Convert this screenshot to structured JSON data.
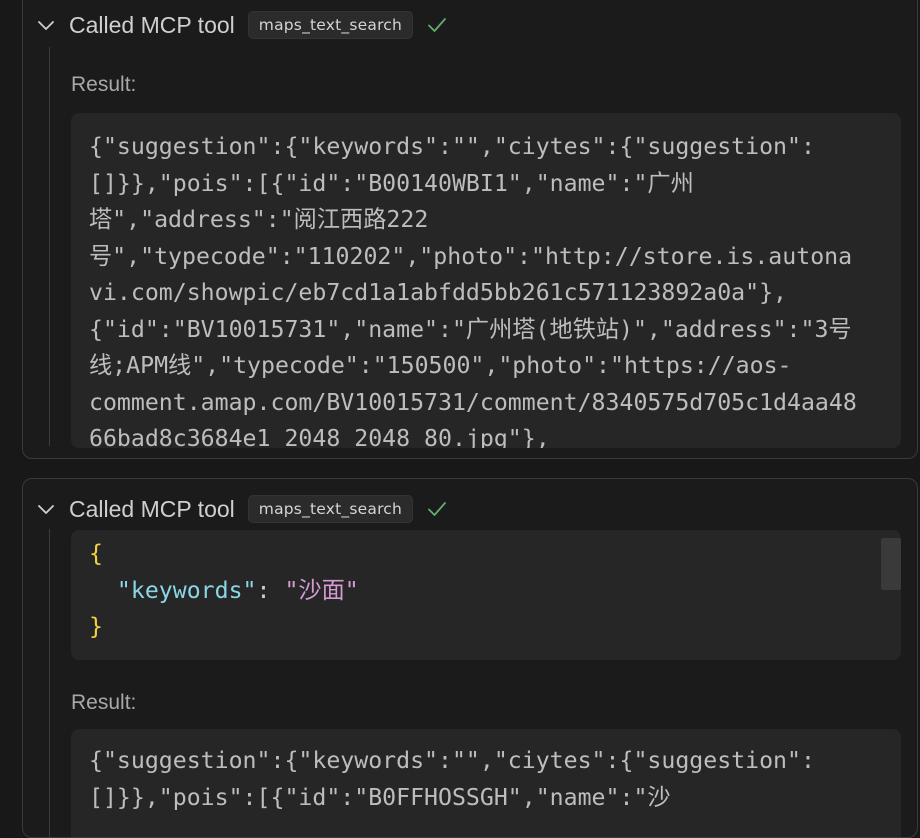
{
  "calls": [
    {
      "title": "Called MCP tool",
      "tool_name": "maps_text_search",
      "result_label": "Result:",
      "result_text": "{\"suggestion\":{\"keywords\":\"\",\"ciytes\":{\"suggestion\":\n[]}},\"pois\":[{\"id\":\"B00140WBI1\",\"name\":\"广州\n塔\",\"address\":\"阅江西路222\n号\",\"typecode\":\"110202\",\"photo\":\"http://store.is.autona\nvi.com/showpic/eb7cd1a1abfdd5bb261c571123892a0a\"},\n{\"id\":\"BV10015731\",\"name\":\"广州塔(地铁站)\",\"address\":\"3号\n线;APM线\",\"typecode\":\"150500\",\"photo\":\"https://aos-\ncomment.amap.com/BV10015731/comment/8340575d705c1d4aa48\n66bad8c3684e1_2048_2048_80.jpg\"},"
    },
    {
      "title": "Called MCP tool",
      "tool_name": "maps_text_search",
      "args": {
        "open_brace": "{",
        "key": "\"keywords\"",
        "colon": ": ",
        "value": "\"沙面\"",
        "close_brace": "}"
      },
      "result_label": "Result:",
      "result_text": "{\"suggestion\":{\"keywords\":\"\",\"ciytes\":{\"suggestion\":\n[]}},\"pois\":[{\"id\":\"B0FFHOSSGH\",\"name\":\"沙"
    }
  ],
  "icons": {
    "collapse": "chevron-down-icon",
    "status": "checkmark-icon"
  },
  "colors": {
    "background": "#181818",
    "code_background": "#262626",
    "check": "#5fae6f",
    "json_brace": "#f2d33f",
    "json_key": "#8bd6e6",
    "json_string": "#d59bd2"
  }
}
